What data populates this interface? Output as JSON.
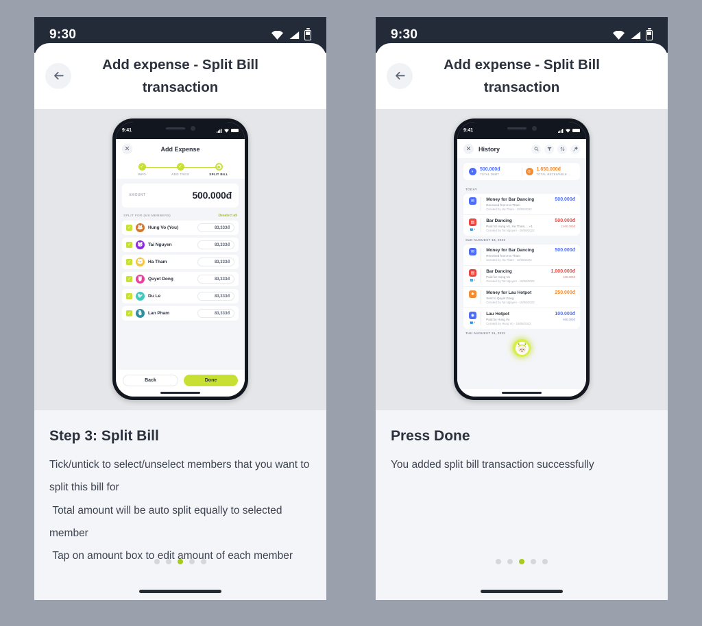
{
  "theme": {
    "accent": "#c8e033",
    "dark": "#242b38",
    "page_bg": "#9aa1ad",
    "panel_bg": "#f4f5f8",
    "mock_bg": "#e4e6e9"
  },
  "panels": [
    {
      "status_bar": {
        "time": "9:30",
        "icons": [
          "wifi-icon",
          "signal-icon",
          "battery-icon"
        ]
      },
      "header": {
        "back_icon": "arrow-left-icon",
        "title": "Add expense - Split Bill transaction"
      },
      "device": {
        "status": {
          "time": "9:41",
          "icons": [
            "signal-icon",
            "wifi-icon",
            "battery-icon"
          ]
        },
        "screen": "add-expense",
        "app_header": {
          "close_icon": "close-icon",
          "title": "Add Expense"
        },
        "stepper": {
          "steps": [
            {
              "label": "INFO",
              "state": "done"
            },
            {
              "label": "ADD TAGS",
              "state": "done"
            },
            {
              "label": "SPLIT BILL",
              "state": "current"
            }
          ]
        },
        "amount": {
          "label": "AMOUNT",
          "value": "500.000đ"
        },
        "split": {
          "section_label": "SPLIT FOR (6/6 MEMBERS)",
          "action_label": "Deselect all",
          "members": [
            {
              "name": "Hung Vo (You)",
              "amount": "83,333đ",
              "checked": true,
              "avatar_color": "#d2772b",
              "avatar_icon": "fox-avatar-icon"
            },
            {
              "name": "Tai Nguyen",
              "amount": "83,333đ",
              "checked": true,
              "avatar_color": "#8d2ae0",
              "avatar_icon": "cat-avatar-icon"
            },
            {
              "name": "Ha Tham",
              "amount": "83,333đ",
              "checked": true,
              "avatar_color": "#f7c53d",
              "avatar_icon": "bear-avatar-icon"
            },
            {
              "name": "Quyet Dong",
              "amount": "83,333đ",
              "checked": true,
              "avatar_color": "#e8409c",
              "avatar_icon": "owl-avatar-icon"
            },
            {
              "name": "Du Le",
              "amount": "83,333đ",
              "checked": true,
              "avatar_color": "#3fc9c0",
              "avatar_icon": "bird-avatar-icon"
            },
            {
              "name": "Lan Pham",
              "amount": "83,333đ",
              "checked": true,
              "avatar_color": "#2e8f9e",
              "avatar_icon": "penguin-avatar-icon"
            }
          ]
        },
        "footer": {
          "back_label": "Back",
          "done_label": "Done"
        }
      },
      "caption": {
        "title": "Step 3: Split Bill",
        "body": "Tick/untick to select/unselect members that you want to split this bill for\n Total amount will be auto split equally to selected member\n Tap on amount box to edit amount of each member"
      },
      "pagination": {
        "count": 5,
        "active_index": 2
      }
    },
    {
      "status_bar": {
        "time": "9:30",
        "icons": [
          "wifi-icon",
          "signal-icon",
          "battery-icon"
        ]
      },
      "header": {
        "back_icon": "arrow-left-icon",
        "title": "Add expense - Split Bill transaction"
      },
      "device": {
        "status": {
          "time": "9:41",
          "icons": [
            "signal-icon",
            "wifi-icon",
            "battery-icon"
          ]
        },
        "screen": "history",
        "app_header": {
          "close_icon": "close-icon",
          "title": "History",
          "actions": [
            "search-icon",
            "filter-icon",
            "sort-icon",
            "pin-icon"
          ]
        },
        "summary": [
          {
            "amount": "500.000đ",
            "label": "TOTAL DEBT →",
            "color": "#4f6ef7",
            "icon": "debt-icon"
          },
          {
            "amount": "1.650.000đ",
            "label": "TOTAL RECEIVABLE →",
            "color": "#f58a2e",
            "icon": "receivable-icon"
          }
        ],
        "groups": [
          {
            "day": "TODAY",
            "transactions": [
              {
                "title": "Money for Bar Dancing",
                "sub": "Received from Ha Tham",
                "meta": "Created by Ha Tham - 28/08/2022",
                "amount": "500.000đ",
                "amount_color": "#4f6ef7",
                "amount2": "",
                "icon_color": "#4f6ef7",
                "icon": "envelope-icon",
                "people": ""
              },
              {
                "title": "Bar Dancing",
                "sub": "Paid for Hung Vo, Ha Tham, ...+1",
                "meta": "Created by Tai Nguyen - 28/08/2022",
                "amount": "500.000đ",
                "amount_color": "#f0453f",
                "amount2": "1.500.000đ",
                "icon_color": "#f0453f",
                "icon": "bill-icon",
                "people": "4"
              }
            ]
          },
          {
            "day": "SUN AUGUEST 18, 2022",
            "transactions": [
              {
                "title": "Money for Bar Dancing",
                "sub": "Received from Ha Tham",
                "meta": "Created by Ha Tham - 18/08/2022",
                "amount": "500.000đ",
                "amount_color": "#4f6ef7",
                "amount2": "",
                "icon_color": "#4f6ef7",
                "icon": "envelope-icon",
                "people": ""
              },
              {
                "title": "Bar Dancing",
                "sub": "Paid for Hung Vo",
                "meta": "Created by Tai Nguyen - 18/08/2022",
                "amount": "1.000.000đ",
                "amount_color": "#f0453f",
                "amount2": "500.000đ",
                "icon_color": "#f0453f",
                "icon": "bill-icon",
                "people": "2"
              },
              {
                "title": "Money for Lau Hotpot",
                "sub": "Sent to Quyet Dong",
                "meta": "Created by Tai Nguyen - 18/08/2022",
                "amount": "250.000đ",
                "amount_color": "#f58a2e",
                "amount2": "",
                "icon_color": "#f58a2e",
                "icon": "hotpot-icon",
                "people": ""
              },
              {
                "title": "Lau Hotpot",
                "sub": "Paid by Hung Vo",
                "meta": "Created by Hung Vo - 18/08/2022",
                "amount": "100.000đ",
                "amount_color": "#4f6ef7",
                "amount2": "500.000đ",
                "icon_color": "#4f6ef7",
                "icon": "pot-icon",
                "people": "4"
              }
            ]
          },
          {
            "day": "THU AUGUEST 15, 2022",
            "transactions": []
          }
        ],
        "loader": {
          "icon": "character-avatar-loader"
        }
      },
      "caption": {
        "title": "Press Done",
        "body": "You added split bill transaction successfully"
      },
      "pagination": {
        "count": 5,
        "active_index": 2
      }
    }
  ]
}
